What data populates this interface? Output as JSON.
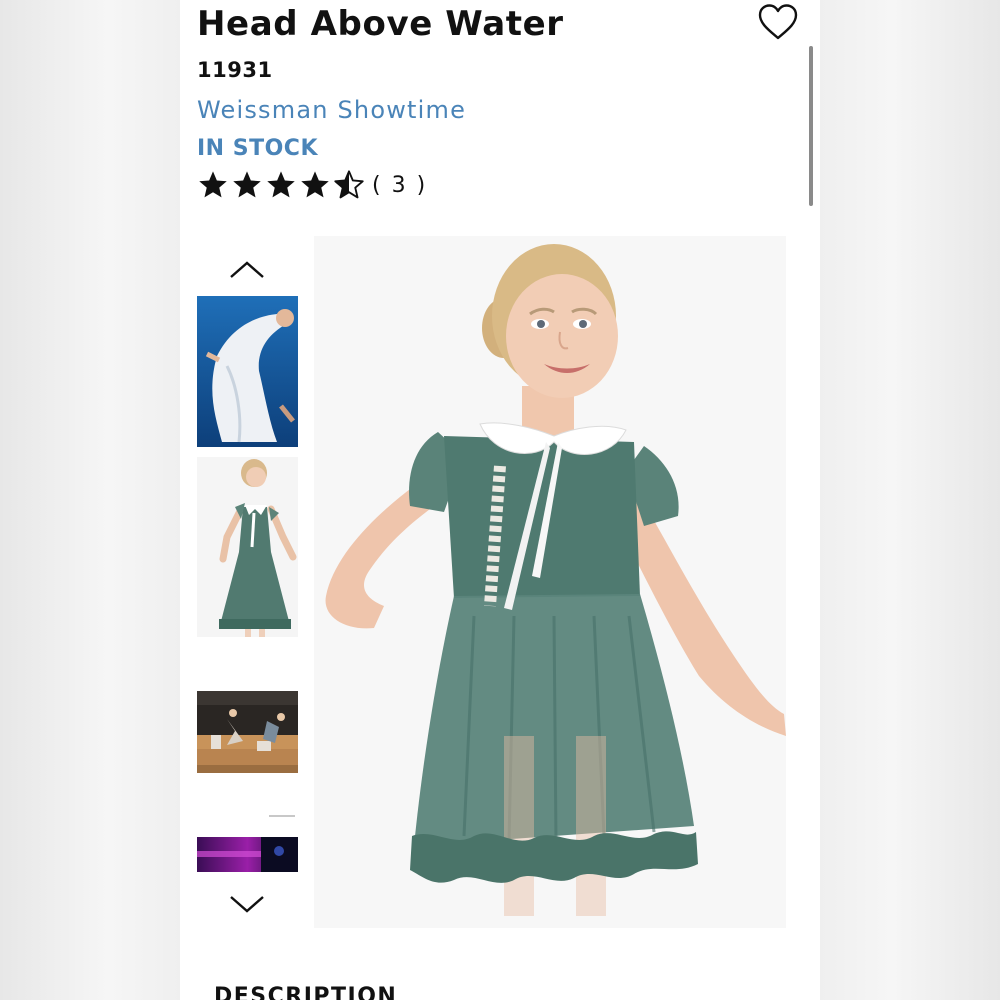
{
  "product": {
    "title": "Head Above Water",
    "sku": "11931",
    "brand": "Weissman Showtime",
    "stock_status": "IN STOCK",
    "rating": 4.5,
    "rating_count": "( 3 )"
  },
  "colors": {
    "brand_blue": "#4a84b8",
    "text_dark": "#111111",
    "dress_green": "#4f7a70"
  },
  "gallery": {
    "thumbnails": [
      {
        "name": "white-dress-dancer"
      },
      {
        "name": "green-dress-girl"
      },
      {
        "name": "stage-dancers"
      },
      {
        "name": "blank-thumbnail"
      },
      {
        "name": "purple-stage"
      }
    ]
  },
  "sections": {
    "description_heading": "DESCRIPTION"
  },
  "icons": [
    "heart-icon",
    "star-icon",
    "chevron-up-icon",
    "chevron-down-icon"
  ]
}
